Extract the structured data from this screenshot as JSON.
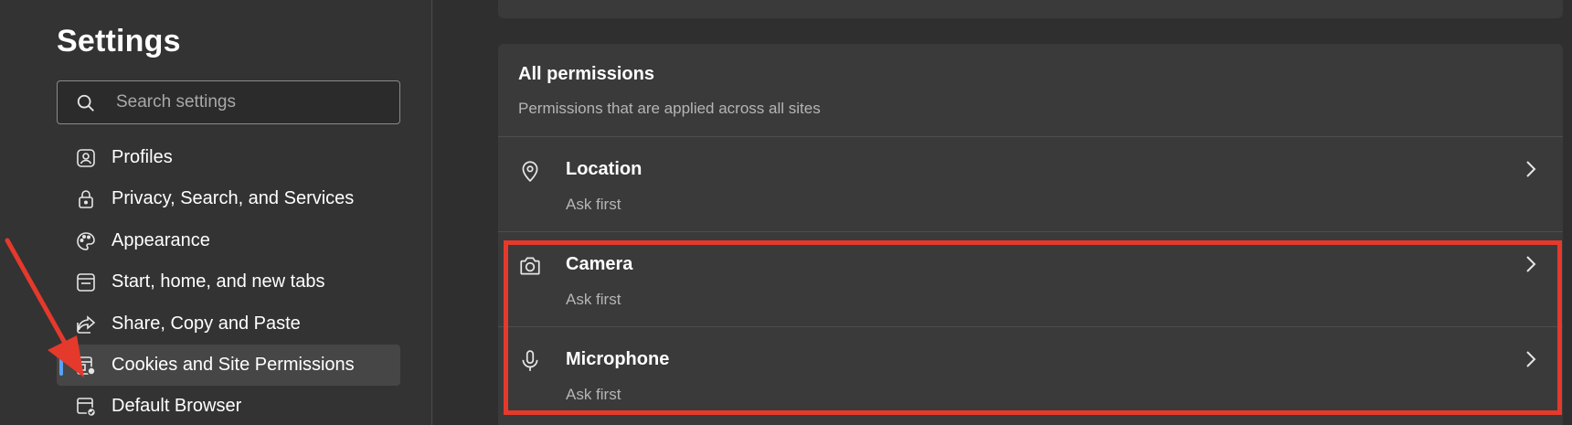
{
  "sidebar": {
    "title": "Settings",
    "search": {
      "placeholder": "Search settings",
      "value": ""
    },
    "items": [
      {
        "label": "Profiles",
        "icon": "profile-icon",
        "active": false
      },
      {
        "label": "Privacy, Search, and Services",
        "icon": "lock-icon",
        "active": false
      },
      {
        "label": "Appearance",
        "icon": "palette-icon",
        "active": false
      },
      {
        "label": "Start, home, and new tabs",
        "icon": "start-page-icon",
        "active": false
      },
      {
        "label": "Share, Copy and Paste",
        "icon": "share-icon",
        "active": false
      },
      {
        "label": "Cookies and Site Permissions",
        "icon": "site-permissions-icon",
        "active": true
      },
      {
        "label": "Default Browser",
        "icon": "default-browser-icon",
        "active": false
      }
    ]
  },
  "main": {
    "permissions": {
      "title": "All permissions",
      "subtitle": "Permissions that are applied across all sites",
      "rows": [
        {
          "name": "Location",
          "status": "Ask first",
          "icon": "location-pin-icon"
        },
        {
          "name": "Camera",
          "status": "Ask first",
          "icon": "camera-icon"
        },
        {
          "name": "Microphone",
          "status": "Ask first",
          "icon": "microphone-icon"
        }
      ]
    }
  },
  "colors": {
    "accent": "#5aa1f2",
    "annotation": "#e5392c",
    "background": "#333333",
    "card": "#3a3a3a"
  }
}
